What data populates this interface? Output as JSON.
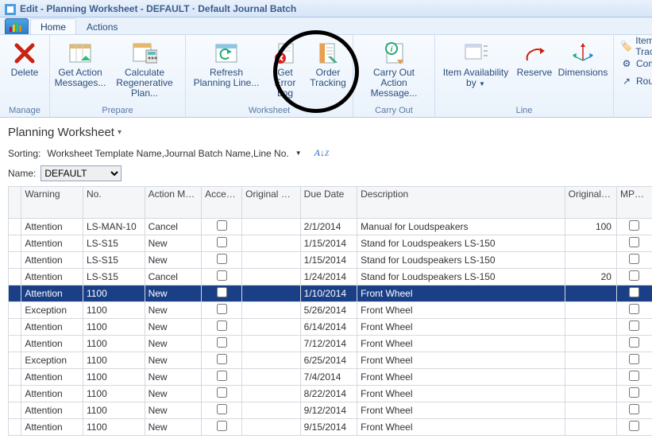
{
  "window": {
    "title": "Edit - Planning Worksheet - DEFAULT · Default Journal Batch"
  },
  "tabs": {
    "home": "Home",
    "actions": "Actions"
  },
  "ribbon": {
    "manage": {
      "label": "Manage",
      "delete": "Delete"
    },
    "prepare": {
      "label": "Prepare",
      "get_action": "Get Action Messages...",
      "calc": "Calculate Regenerative Plan..."
    },
    "worksheet": {
      "label": "Worksheet",
      "refresh": "Refresh Planning Line...",
      "error": "Get Error Log",
      "track": "Order Tracking"
    },
    "carryout": {
      "label": "Carry Out",
      "carry": "Carry Out Action Message..."
    },
    "line": {
      "label": "Line",
      "avail": "Item Availability by",
      "reserve": "Reserve",
      "dims": "Dimensions"
    },
    "side": {
      "itemtrack": "Item Tracking",
      "components": "Components",
      "routing": "Routing"
    }
  },
  "page": {
    "title": "Planning Worksheet",
    "sorting_label": "Sorting:",
    "sorting_value": "Worksheet Template Name,Journal Batch Name,Line No.",
    "name_label": "Name:",
    "name_value": "DEFAULT"
  },
  "columns": {
    "warning": "Warning",
    "no": "No.",
    "action": "Action Message",
    "accept": "Accept Action Mes...",
    "origdue": "Original Due Date",
    "due": "Due Date",
    "desc": "Description",
    "origqty": "Original Quantity",
    "mps": "MPS Order"
  },
  "rows": [
    {
      "warning": "Attention",
      "no": "LS-MAN-10",
      "action": "Cancel",
      "accept": false,
      "origdue": "",
      "due": "2/1/2014",
      "desc": "Manual for Loudspeakers",
      "qty": "100",
      "mps": false,
      "sel": false
    },
    {
      "warning": "Attention",
      "no": "LS-S15",
      "action": "New",
      "accept": false,
      "origdue": "",
      "due": "1/15/2014",
      "desc": "Stand for Loudspeakers LS-150",
      "qty": "",
      "mps": false,
      "sel": false
    },
    {
      "warning": "Attention",
      "no": "LS-S15",
      "action": "New",
      "accept": false,
      "origdue": "",
      "due": "1/15/2014",
      "desc": "Stand for Loudspeakers LS-150",
      "qty": "",
      "mps": false,
      "sel": false
    },
    {
      "warning": "Attention",
      "no": "LS-S15",
      "action": "Cancel",
      "accept": false,
      "origdue": "",
      "due": "1/24/2014",
      "desc": "Stand for Loudspeakers LS-150",
      "qty": "20",
      "mps": false,
      "sel": false
    },
    {
      "warning": "Attention",
      "no": "1100",
      "action": "New",
      "accept": false,
      "origdue": "",
      "due": "1/10/2014",
      "desc": "Front Wheel",
      "qty": "",
      "mps": false,
      "sel": true
    },
    {
      "warning": "Exception",
      "no": "1100",
      "action": "New",
      "accept": false,
      "origdue": "",
      "due": "5/26/2014",
      "desc": "Front Wheel",
      "qty": "",
      "mps": false,
      "sel": false
    },
    {
      "warning": "Attention",
      "no": "1100",
      "action": "New",
      "accept": false,
      "origdue": "",
      "due": "6/14/2014",
      "desc": "Front Wheel",
      "qty": "",
      "mps": false,
      "sel": false
    },
    {
      "warning": "Attention",
      "no": "1100",
      "action": "New",
      "accept": false,
      "origdue": "",
      "due": "7/12/2014",
      "desc": "Front Wheel",
      "qty": "",
      "mps": false,
      "sel": false
    },
    {
      "warning": "Exception",
      "no": "1100",
      "action": "New",
      "accept": false,
      "origdue": "",
      "due": "6/25/2014",
      "desc": "Front Wheel",
      "qty": "",
      "mps": false,
      "sel": false
    },
    {
      "warning": "Attention",
      "no": "1100",
      "action": "New",
      "accept": false,
      "origdue": "",
      "due": "7/4/2014",
      "desc": "Front Wheel",
      "qty": "",
      "mps": false,
      "sel": false
    },
    {
      "warning": "Attention",
      "no": "1100",
      "action": "New",
      "accept": false,
      "origdue": "",
      "due": "8/22/2014",
      "desc": "Front Wheel",
      "qty": "",
      "mps": false,
      "sel": false
    },
    {
      "warning": "Attention",
      "no": "1100",
      "action": "New",
      "accept": false,
      "origdue": "",
      "due": "9/12/2014",
      "desc": "Front Wheel",
      "qty": "",
      "mps": false,
      "sel": false
    },
    {
      "warning": "Attention",
      "no": "1100",
      "action": "New",
      "accept": false,
      "origdue": "",
      "due": "9/15/2014",
      "desc": "Front Wheel",
      "qty": "",
      "mps": false,
      "sel": false
    }
  ]
}
